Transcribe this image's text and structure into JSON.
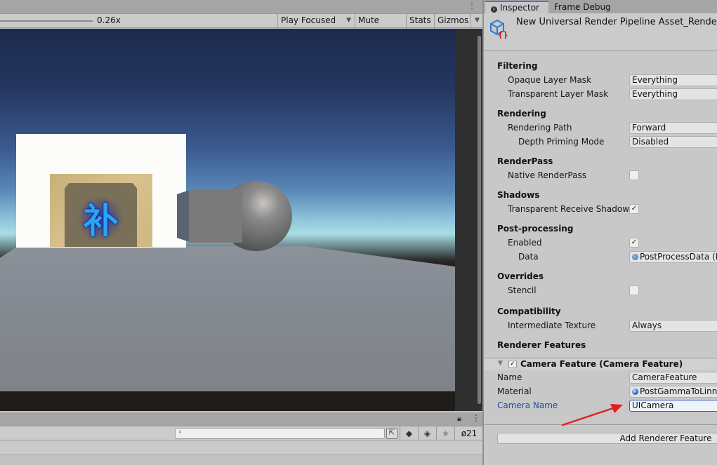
{
  "game_view": {
    "scale_value": "0.26x",
    "play_mode": "Play Focused",
    "mute_audio": "Mute Audio",
    "stats": "Stats",
    "gizmos": "Gizmos",
    "card_glyph": "补",
    "icons": {
      "kebab": "⋮",
      "dropdown": "▼"
    }
  },
  "project_panel": {
    "search_placeholder": "",
    "hidden_count": "21",
    "icons": {
      "lock": "🔓",
      "kebab": "⋮",
      "search": "🔍",
      "expand": "⇱",
      "filter_type": "◆",
      "filter_label": "◈",
      "favorite": "★",
      "hidden": "ø"
    }
  },
  "inspector": {
    "tabs": [
      "Inspector",
      "Frame Debug"
    ],
    "asset_title": "New Universal Render Pipeline Asset_Renderer",
    "sections": {
      "filtering": {
        "title": "Filtering",
        "opaque_label": "Opaque Layer Mask",
        "opaque_value": "Everything",
        "transparent_label": "Transparent Layer Mask",
        "transparent_value": "Everything"
      },
      "rendering": {
        "title": "Rendering",
        "path_label": "Rendering Path",
        "path_value": "Forward",
        "depth_label": "Depth Priming Mode",
        "depth_value": "Disabled"
      },
      "renderpass": {
        "title": "RenderPass",
        "native_label": "Native RenderPass",
        "native_checked": false
      },
      "shadows": {
        "title": "Shadows",
        "trs_label": "Transparent Receive Shadows",
        "trs_checked": true
      },
      "postprocessing": {
        "title": "Post-processing",
        "enabled_label": "Enabled",
        "enabled_checked": true,
        "data_label": "Data",
        "data_value": "PostProcessData (Post Process Data)"
      },
      "overrides": {
        "title": "Overrides",
        "stencil_label": "Stencil",
        "stencil_checked": false
      },
      "compatibility": {
        "title": "Compatibility",
        "intermediate_label": "Intermediate Texture",
        "intermediate_value": "Always"
      },
      "renderer_features": {
        "title": "Renderer Features",
        "feature": {
          "title": "Camera Feature (Camera Feature)",
          "enabled": true,
          "name_label": "Name",
          "name_value": "CameraFeature",
          "material_label": "Material",
          "material_value": "PostGammaToLinnear",
          "camera_name_label": "Camera Name",
          "camera_name_value": "UICamera"
        },
        "add_button": "Add Renderer Feature"
      }
    },
    "check_glyph": "✓",
    "colors": {
      "accent_tab": "#3a79d0",
      "highlight_label": "#1f4d9a",
      "annotation_arrow": "#e02020"
    }
  }
}
